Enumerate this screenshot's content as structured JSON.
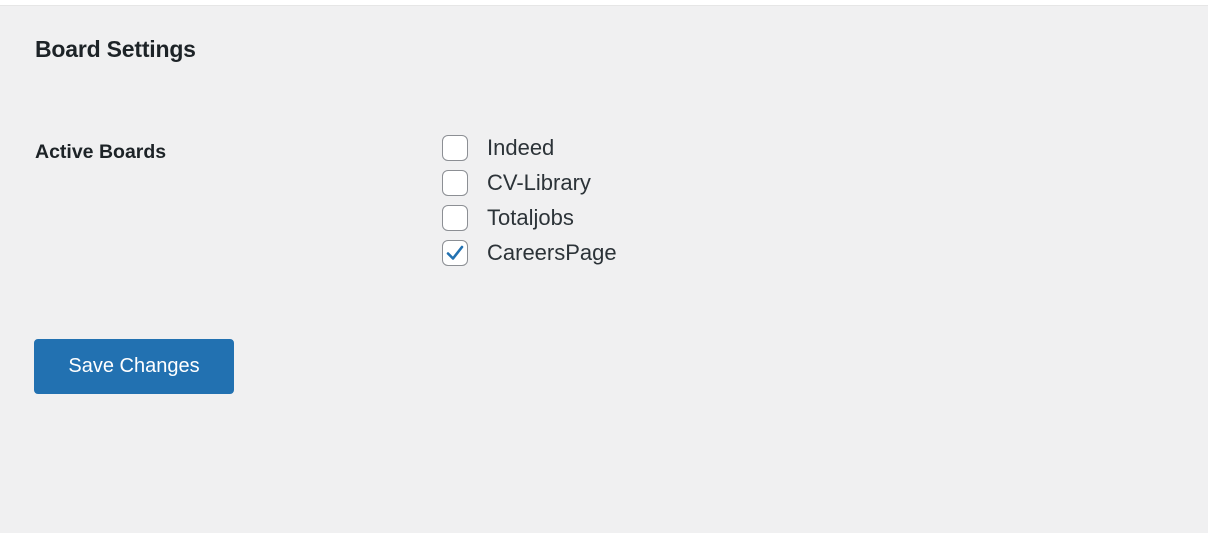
{
  "page": {
    "title": "Board Settings"
  },
  "settings": {
    "active_boards_label": "Active Boards",
    "boards": [
      {
        "label": "Indeed",
        "checked": false
      },
      {
        "label": "CV-Library",
        "checked": false
      },
      {
        "label": "Totaljobs",
        "checked": false
      },
      {
        "label": "CareersPage",
        "checked": true
      }
    ]
  },
  "actions": {
    "save_label": "Save Changes"
  },
  "colors": {
    "background": "#f0f0f1",
    "button": "#2271b1",
    "check": "#2271b1"
  }
}
